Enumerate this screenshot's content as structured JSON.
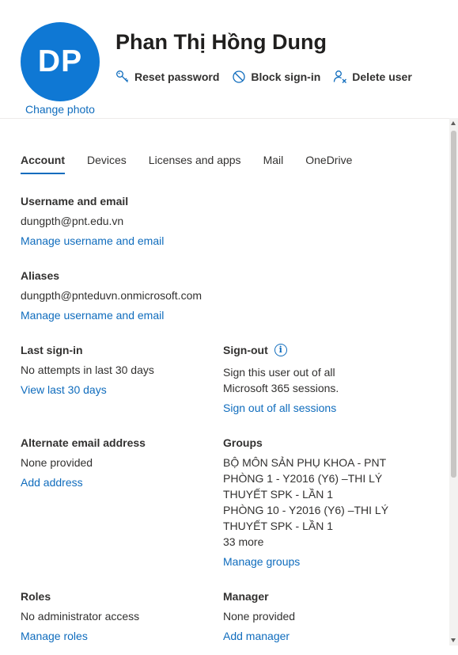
{
  "user": {
    "initials": "DP",
    "name": "Phan Thị Hồng Dung",
    "change_photo": "Change photo"
  },
  "actions": [
    {
      "label": "Reset password",
      "icon": "key-icon"
    },
    {
      "label": "Block sign-in",
      "icon": "block-icon"
    },
    {
      "label": "Delete user",
      "icon": "delete-user-icon"
    }
  ],
  "tabs": [
    "Account",
    "Devices",
    "Licenses and apps",
    "Mail",
    "OneDrive"
  ],
  "active_tab": "Account",
  "username_email": {
    "heading": "Username and email",
    "value": "dungpth@pnt.edu.vn",
    "link": "Manage username and email"
  },
  "aliases": {
    "heading": "Aliases",
    "value": "dungpth@pnteduvn.onmicrosoft.com",
    "link": "Manage username and email"
  },
  "last_signin": {
    "heading": "Last sign-in",
    "value": "No attempts in last 30 days",
    "link": "View last 30 days"
  },
  "signout": {
    "heading": "Sign-out",
    "line1": "Sign this user out of all",
    "line2": "Microsoft 365 sessions.",
    "link": "Sign out of all sessions"
  },
  "alt_email": {
    "heading": "Alternate email address",
    "value": "None provided",
    "link": "Add address"
  },
  "groups": {
    "heading": "Groups",
    "lines": [
      "BỘ MÔN SẢN PHỤ KHOA - PNT",
      "PHÒNG 1 - Y2016 (Y6) –THI LÝ",
      "THUYẾT SPK - LẦN 1",
      "PHÒNG 10 - Y2016 (Y6) –THI LÝ",
      "THUYẾT SPK - LẦN 1",
      "33 more"
    ],
    "link": "Manage groups"
  },
  "roles": {
    "heading": "Roles",
    "value": "No administrator access",
    "link": "Manage roles"
  },
  "manager": {
    "heading": "Manager",
    "value": "None provided",
    "link": "Add manager"
  },
  "colors": {
    "accent": "#0f6cbd",
    "avatar": "#0f78d4",
    "text": "#323130"
  }
}
